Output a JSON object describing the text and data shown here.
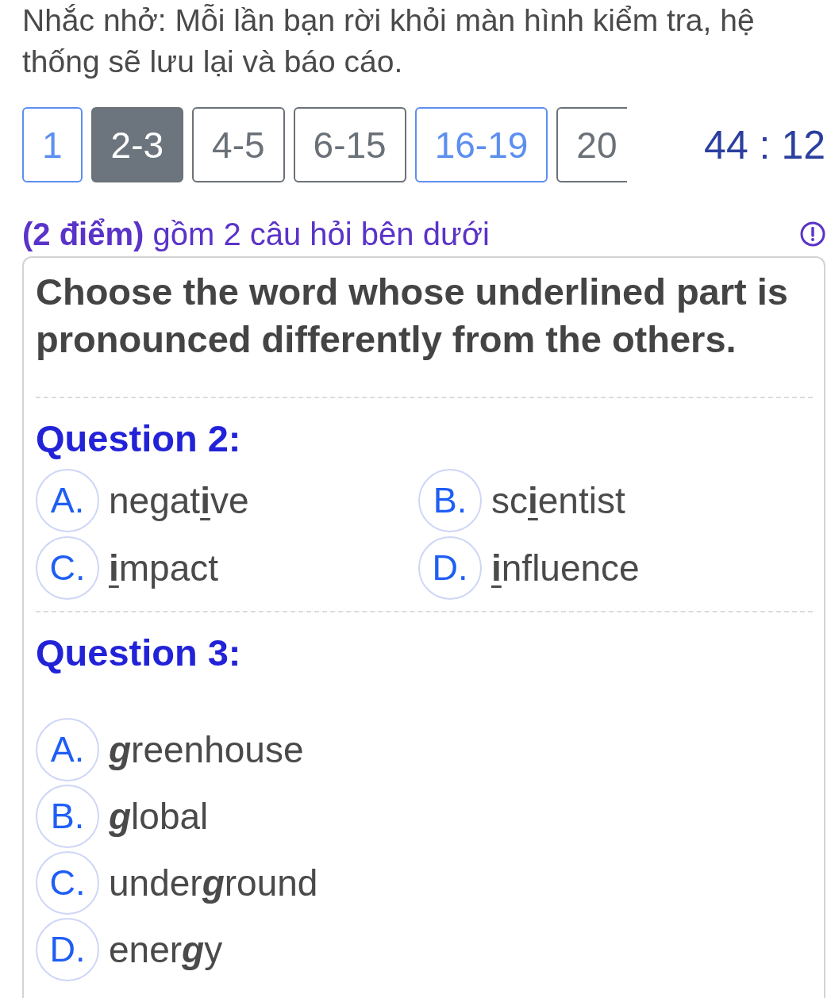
{
  "notice": "Nhắc nhở: Mỗi lần bạn rời khỏi màn hình kiểm tra, hệ thống sẽ lưu lại và báo cáo.",
  "question_tabs": [
    {
      "label": "1",
      "selected": false,
      "answered": true
    },
    {
      "label": "2-3",
      "selected": true,
      "answered": false
    },
    {
      "label": "4-5",
      "selected": false,
      "answered": false
    },
    {
      "label": "6-15",
      "selected": false,
      "answered": false
    },
    {
      "label": "16-19",
      "selected": false,
      "answered": true
    },
    {
      "label": "20",
      "selected": false,
      "answered": false
    }
  ],
  "timer": "44 : 12",
  "section": {
    "title": "**(2 điểm)** gồm 2 câu hỏi bên dưới"
  },
  "instruction": "Choose the word whose underlined part is pronounced differently from the others.",
  "questions": [
    {
      "title": "Question 2:",
      "kind": "underline",
      "options": [
        {
          "letter": "A.",
          "text": "negat**i**ve",
          "selected": false
        },
        {
          "letter": "B.",
          "text": "sc**i**entist",
          "selected": false
        },
        {
          "letter": "C.",
          "text": "**i**mpact",
          "selected": false
        },
        {
          "letter": "D.",
          "text": "**i**nfluence",
          "selected": false
        }
      ]
    },
    {
      "title": "Question 3:",
      "kind": "italic",
      "options": [
        {
          "letter": "A.",
          "text": "**g**reenhouse",
          "selected": false
        },
        {
          "letter": "B.",
          "text": "**g**lobal",
          "selected": false
        },
        {
          "letter": "C.",
          "text": "under**g**round",
          "selected": false
        },
        {
          "letter": "D.",
          "text": "ener**g**y",
          "selected": false
        }
      ]
    }
  ]
}
